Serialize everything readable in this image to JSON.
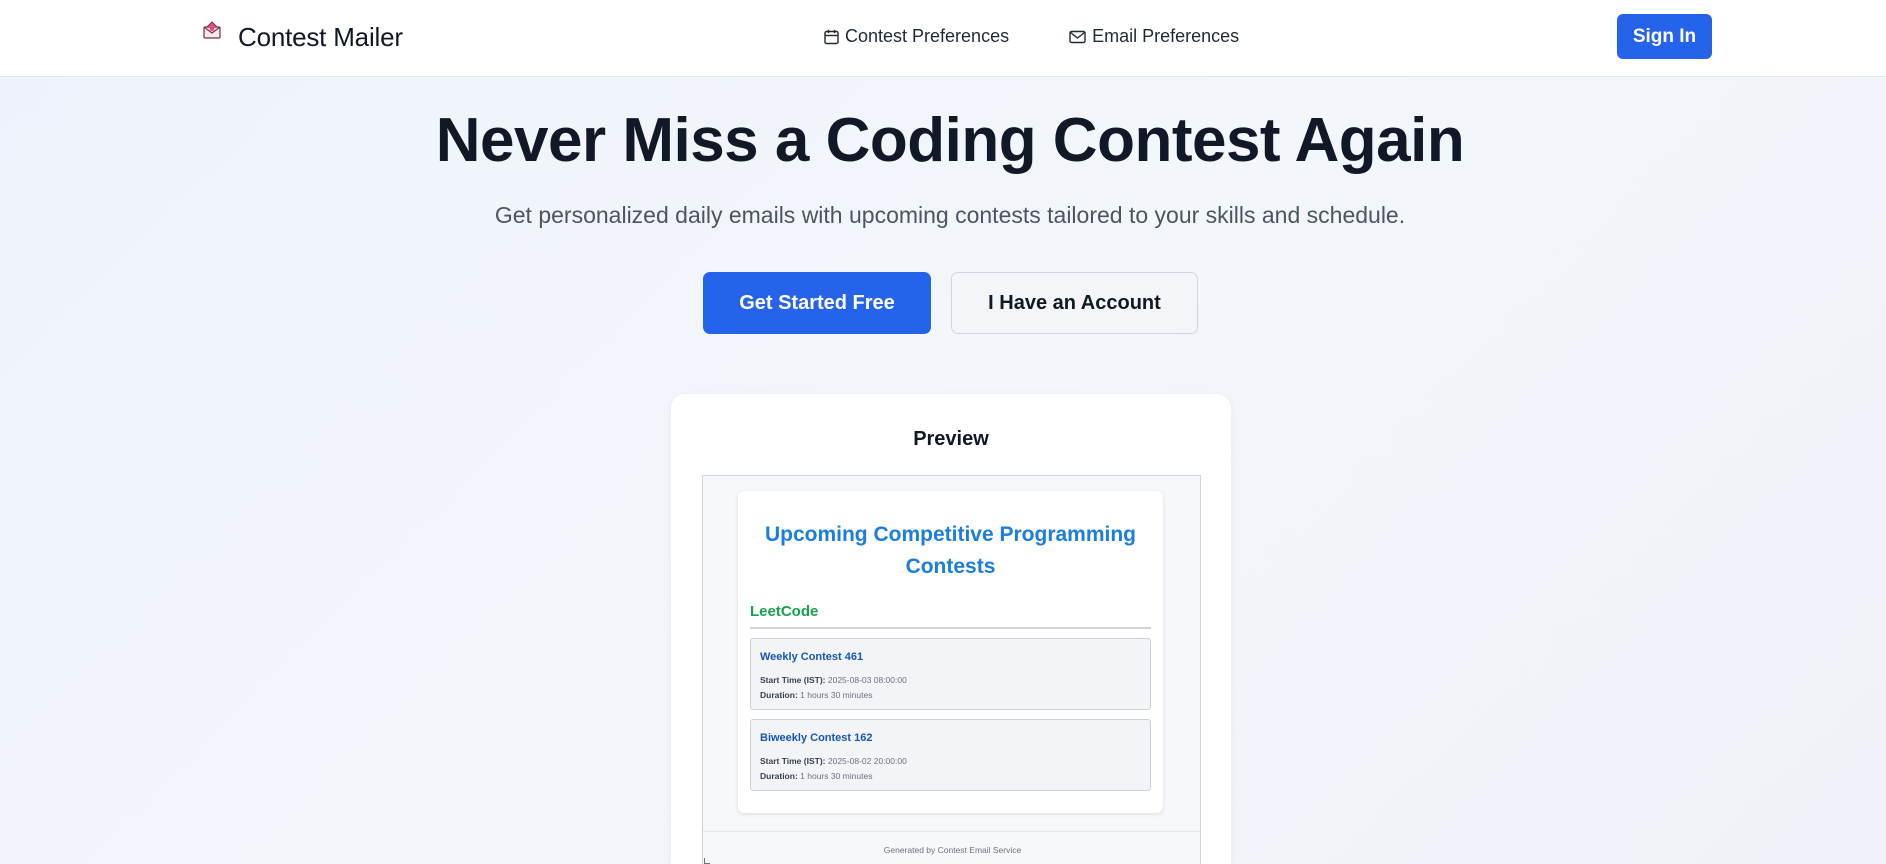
{
  "navbar": {
    "brand_name": "Contest Mailer",
    "logo_icon": "envelope-logo-icon",
    "links": [
      {
        "label": "Contest Preferences",
        "icon": "calendar-icon"
      },
      {
        "label": "Email Preferences",
        "icon": "mail-icon"
      }
    ],
    "signin_label": "Sign In"
  },
  "hero": {
    "title": "Never Miss a Coding Contest Again",
    "subtitle": "Get personalized daily emails with upcoming contests tailored to your skills and schedule.",
    "primary_cta": "Get Started Free",
    "secondary_cta": "I Have an Account"
  },
  "preview": {
    "label": "Preview",
    "email": {
      "title": "Upcoming Competitive Programming Contests",
      "platform": "LeetCode",
      "contests": [
        {
          "name": "Weekly Contest 461",
          "start_label": "Start Time (IST):",
          "start_value": "2025-08-03 08:00:00",
          "duration_label": "Duration:",
          "duration_value": "1 hours 30 minutes"
        },
        {
          "name": "Biweekly Contest 162",
          "start_label": "Start Time (IST):",
          "start_value": "2025-08-02 20:00:00",
          "duration_label": "Duration:",
          "duration_value": "1 hours 30 minutes"
        }
      ],
      "footer": "Generated by Contest Email Service"
    }
  },
  "colors": {
    "primary": "#2563eb",
    "email_title": "#1a7de0",
    "platform": "#16a34a",
    "contest_name": "#1556b8"
  }
}
